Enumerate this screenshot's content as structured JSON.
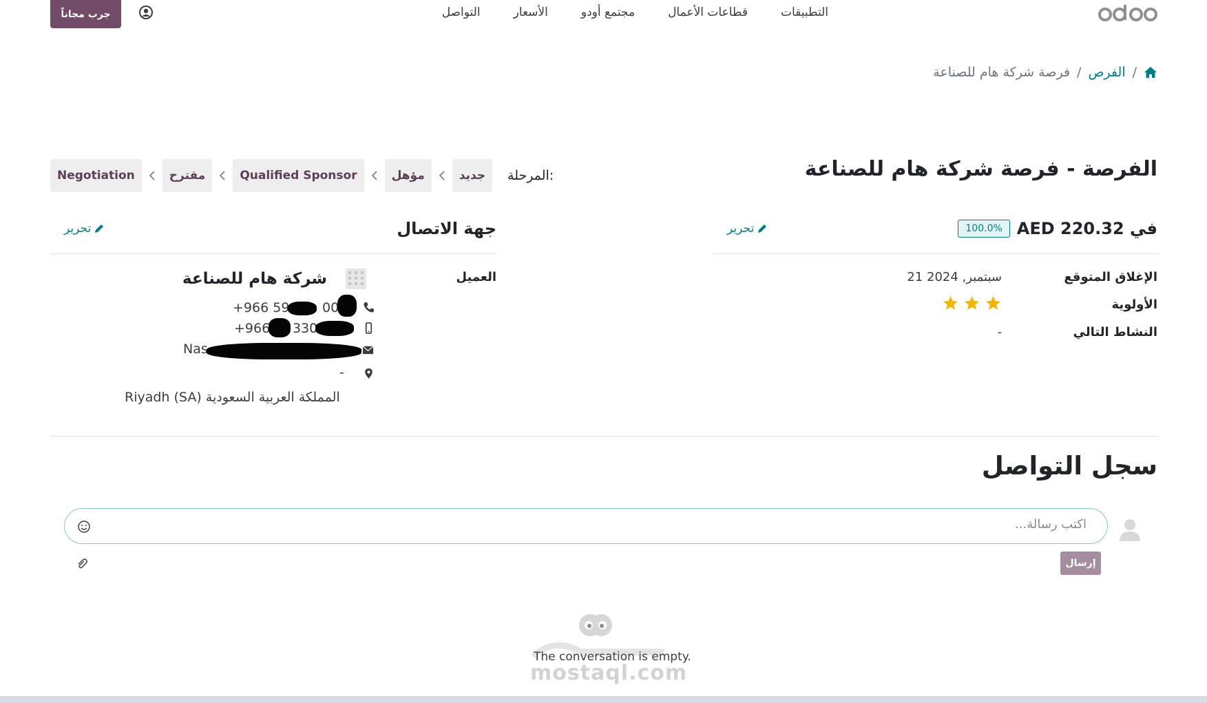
{
  "navbar": {
    "brand": "odoo",
    "links": [
      "التطبيقات",
      "قطاعات الأعمال",
      "مجتمع أودو",
      "الأسعار",
      "التواصل"
    ],
    "try_free": "جرب مجاناً"
  },
  "breadcrumb": {
    "parent": "الفرص",
    "separator": "/",
    "current": "فرصة شركة هام للصناعة"
  },
  "page_title": "الفرصة - فرصة شركة هام للصناعة",
  "stage": {
    "label": "المرحلة:",
    "items": [
      "جديد",
      "مؤهل",
      "Qualified Sponsor",
      "مقترح",
      "Negotiation"
    ]
  },
  "opportunity": {
    "amount": "AED 220.32 في",
    "probability": "100.0%",
    "edit_label": "تحرير",
    "fields": [
      {
        "label": "الإغلاق المتوقع",
        "value": "21 سبتمبر, 2024"
      },
      {
        "label": "الأولوية",
        "value": ""
      },
      {
        "label": "النشاط التالي",
        "value": "-"
      }
    ],
    "priority_stars": 3
  },
  "contact": {
    "title": "جهة الاتصال",
    "edit_label": "تحرير",
    "customer_label": "العميل",
    "customer_name": "شركة هام للصناعة",
    "phone": "+966 59",
    "phone_suffix": "00",
    "mobile": "+966",
    "mobile_suffix": "330",
    "email": "Nas",
    "address_line": "-",
    "city_country": "Riyadh (SA) المملكة العربية السعودية"
  },
  "chatter": {
    "title": "سجل التواصل",
    "placeholder": "اكتب رسالة...",
    "send": "إرسال",
    "empty": "The conversation is empty."
  },
  "watermark": "mostaql.com",
  "colors": {
    "primary": "#714b67",
    "link": "#017e84",
    "star": "#f3b600"
  }
}
